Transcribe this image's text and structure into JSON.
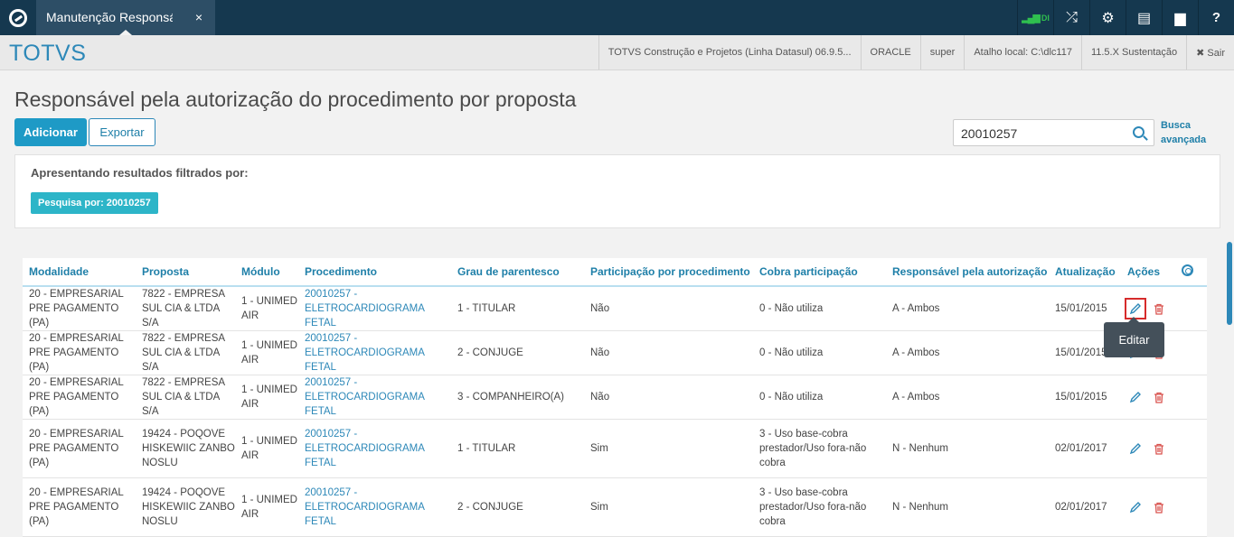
{
  "app": {
    "tab_title": "Manutenção Responsá",
    "tab_close": "×",
    "brand": "TOTVS"
  },
  "topbar_icons": [
    {
      "name": "signal-icon",
      "glyph": "▂▄▆",
      "label": "DI"
    },
    {
      "name": "shuffle-icon",
      "glyph": "⤮"
    },
    {
      "name": "gear-icon",
      "glyph": "⚙"
    },
    {
      "name": "document-icon",
      "glyph": "▤"
    },
    {
      "name": "chat-icon",
      "glyph": "▆"
    },
    {
      "name": "help-icon",
      "glyph": "?"
    }
  ],
  "header_info": {
    "product": "TOTVS Construção e Projetos (Linha Datasul) 06.9.5...",
    "db": "ORACLE",
    "user": "super",
    "shortcut": "Atalho local: C:\\dlc117",
    "version": "11.5.X Sustentação",
    "logout": "✖ Sair"
  },
  "page": {
    "title": "Responsável pela autorização do procedimento por proposta",
    "add_button": "Adicionar",
    "export_button": "Exportar",
    "search_value": "20010257",
    "advanced_search": "Busca avançada",
    "filter_title": "Apresentando resultados filtrados por:",
    "filter_tag": "Pesquisa por: 20010257",
    "tooltip": "Editar"
  },
  "table": {
    "columns": [
      "Modalidade",
      "Proposta",
      "Módulo",
      "Procedimento",
      "Grau de parentesco",
      "Participação por procedimento",
      "Cobra participação",
      "Responsável pela autorização",
      "Atualização",
      "Ações"
    ],
    "rows": [
      [
        "20 - EMPRESARIAL PRE PAGAMENTO (PA)",
        "7822 - EMPRESA SUL CIA & LTDA S/A",
        "1 - UNIMED AIR",
        "20010257 - ELETROCARDIOGRAMA FETAL",
        "1 - TITULAR",
        "Não",
        "0 - Não utiliza",
        "A - Ambos",
        "15/01/2015"
      ],
      [
        "20 - EMPRESARIAL PRE PAGAMENTO (PA)",
        "7822 - EMPRESA SUL CIA & LTDA S/A",
        "1 - UNIMED AIR",
        "20010257 - ELETROCARDIOGRAMA FETAL",
        "2 - CONJUGE",
        "Não",
        "0 - Não utiliza",
        "A - Ambos",
        "15/01/2015"
      ],
      [
        "20 - EMPRESARIAL PRE PAGAMENTO (PA)",
        "7822 - EMPRESA SUL CIA & LTDA S/A",
        "1 - UNIMED AIR",
        "20010257 - ELETROCARDIOGRAMA FETAL",
        "3 - COMPANHEIRO(A)",
        "Não",
        "0 - Não utiliza",
        "A - Ambos",
        "15/01/2015"
      ],
      [
        "20 - EMPRESARIAL PRE PAGAMENTO (PA)",
        "19424 - POQOVE HISKEWIIC ZANBO NOSLU",
        "1 - UNIMED AIR",
        "20010257 - ELETROCARDIOGRAMA FETAL",
        "1 - TITULAR",
        "Sim",
        "3 - Uso base-cobra prestador/Uso fora-não cobra",
        "N - Nenhum",
        "02/01/2017"
      ],
      [
        "20 - EMPRESARIAL PRE PAGAMENTO (PA)",
        "19424 - POQOVE HISKEWIIC ZANBO NOSLU",
        "1 - UNIMED AIR",
        "20010257 - ELETROCARDIOGRAMA FETAL",
        "2 - CONJUGE",
        "Sim",
        "3 - Uso base-cobra prestador/Uso fora-não cobra",
        "N - Nenhum",
        "02/01/2017"
      ]
    ]
  },
  "colors": {
    "topbar": "#15384f",
    "accent": "#1e9ac6",
    "tag": "#2db5c8",
    "delete": "#d9534f"
  }
}
